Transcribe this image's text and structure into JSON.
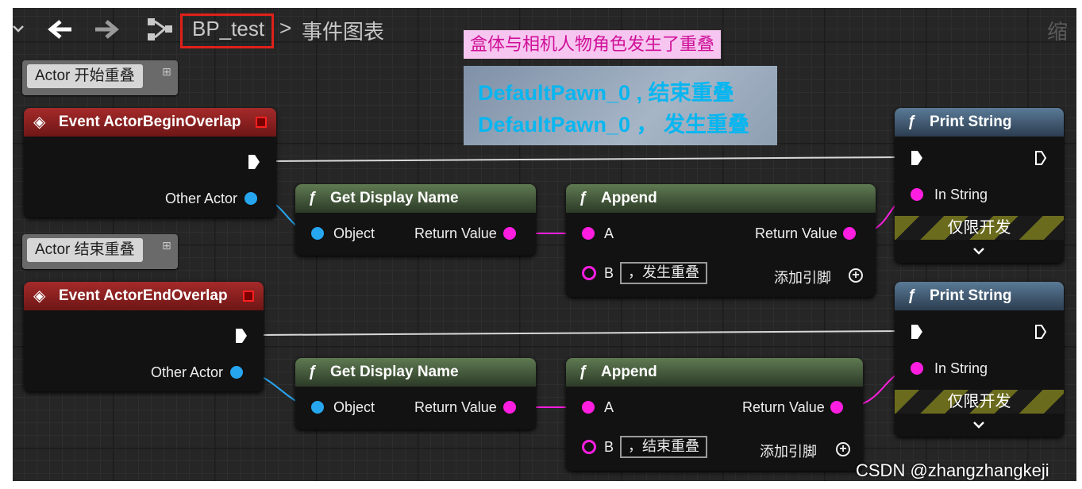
{
  "toolbar": {
    "menu_icon": "chevron-down-icon",
    "back_icon": "arrow-left-icon",
    "forward_icon": "arrow-right-icon",
    "graph_icon": "blueprint-graph-icon",
    "blueprint_name": "BP_test",
    "separator": ">",
    "graph_name": "事件图表",
    "zoom_label": "缩"
  },
  "annotations": {
    "pink_note": "盒体与相机人物角色发生了重叠",
    "screenshot_line1": "DefaultPawn_0 , 结束重叠",
    "screenshot_line2": "DefaultPawn_0 ， 发生重叠"
  },
  "comments": {
    "begin": "Actor 开始重叠",
    "end": "Actor 结束重叠"
  },
  "nodes": {
    "begin_event": {
      "title": "Event ActorBeginOverlap",
      "other_actor": "Other Actor"
    },
    "end_event": {
      "title": "Event ActorEndOverlap",
      "other_actor": "Other Actor"
    },
    "get_name_1": {
      "title": "Get Display Name",
      "object": "Object",
      "return": "Return Value"
    },
    "get_name_2": {
      "title": "Get Display Name",
      "object": "Object",
      "return": "Return Value"
    },
    "append_1": {
      "title": "Append",
      "a": "A",
      "b": "B",
      "b_value": "，发生重叠",
      "return": "Return Value",
      "add_pin": "添加引脚"
    },
    "append_2": {
      "title": "Append",
      "a": "A",
      "b": "B",
      "b_value": "，结束重叠",
      "return": "Return Value",
      "add_pin": "添加引脚"
    },
    "print_1": {
      "title": "Print String",
      "in_string": "In String",
      "dev_only": "仅限开发"
    },
    "print_2": {
      "title": "Print String",
      "in_string": "In String",
      "dev_only": "仅限开发"
    }
  },
  "watermark": "CSDN @zhangzhangkeji",
  "colors": {
    "exec": "#ffffff",
    "object_pin": "#27a6f0",
    "string_pin": "#ff1ee0",
    "event_header": "#a52a2a",
    "function_header": "#5f7a52"
  }
}
